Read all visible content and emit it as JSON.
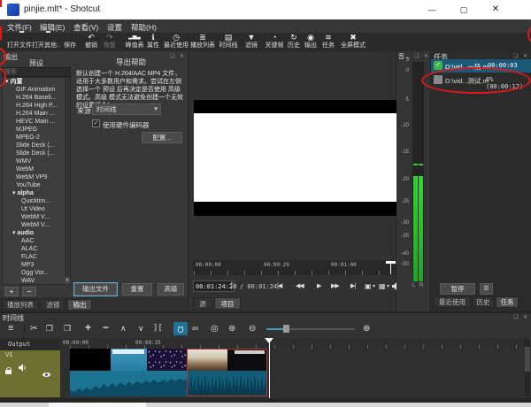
{
  "window": {
    "title": "pinjie.mlt* - Shotcut"
  },
  "menu": {
    "items": [
      "文件(F)",
      "编辑(E)",
      "查看(V)",
      "设置",
      "帮助(H)"
    ]
  },
  "toolbar": {
    "items": [
      "打开文件",
      "打开其他..",
      "保存",
      "撤销",
      "恢复",
      "峰值表",
      "属性",
      "最近使用",
      "播放列表",
      "时间线",
      "滤镜",
      "关键帧",
      "历史",
      "输出",
      "任务",
      "全屏模式"
    ]
  },
  "export_panel": {
    "title": "输出",
    "presets_title": "预设",
    "search_placeholder": "搜索",
    "group_builtin": "内置",
    "group_alpha": "alpha",
    "group_audio": "audio",
    "builtin_items": [
      "GIF Animation",
      "H.264 Baseli...",
      "H.264 High P...",
      "H.264 Main ...",
      "HEVC Main ...",
      "MJPEG",
      "MPEG-2",
      "Slide Deck (...",
      "Slide Deck (...",
      "WMV",
      "WebM",
      "WebM VP9",
      "YouTube"
    ],
    "alpha_items": [
      "Quicktim...",
      "Ut Video",
      "WebM V...",
      "WebM V..."
    ],
    "audio_items": [
      "AAC",
      "ALAC",
      "FLAC",
      "MP3",
      "Ogg Vor...",
      "WAV"
    ],
    "add_label": "+",
    "remove_label": "−",
    "help_title": "导出帮助",
    "help_text": "默认创建一个 H.264/AAC MP4 文件，适用于大多数用户和需求。尝试在左侧选择一个 预设 后再决定是否使用 高级 模式。高级 模式无法避免创建一个无效的设置组合！",
    "source_label": "来源",
    "source_value": "时间线",
    "hw_encoder_label": "使用硬件编码器",
    "configure_label": "配置...",
    "export_file": "输出文件",
    "reset": "重置",
    "advanced": "高级"
  },
  "left_tabs": {
    "items": [
      "播放列表",
      "滤镜",
      "输出"
    ]
  },
  "player": {
    "ruler": [
      "00:00:00",
      "00:00:29",
      "00:01:00"
    ],
    "position": "00:01:24:20",
    "duration": "/ 00:01:24:",
    "tabs": [
      "源",
      "项目"
    ]
  },
  "meter": {
    "title": "音…",
    "ticks": [
      "3",
      "0",
      "-5",
      "-10",
      "-15",
      "-20",
      "-25",
      "-30",
      "-35",
      "-40",
      "-50"
    ],
    "channel_l": "L",
    "channel_r": "R"
  },
  "jobs": {
    "title": "任务",
    "rows": [
      {
        "name": "D:\\vid...一段.m",
        "status": "00:00:03"
      },
      {
        "name": "D:\\vid...测试.m",
        "status": "6% (00:00:12)"
      }
    ],
    "pause": "暂停",
    "tabs": [
      "最近使用",
      "历史",
      "任务"
    ]
  },
  "timeline": {
    "title": "时间线",
    "ruler": [
      "00:00:00",
      "00:00:35"
    ],
    "track_output": "Output",
    "track_v1": "V1"
  },
  "icons": {
    "undo": "↶",
    "redo": "↷",
    "meter": "▂▅▃",
    "info": "ℹ",
    "clock": "◷",
    "playlist": "≣",
    "timeline": "▤",
    "filter": "▼",
    "keyframes": "◔",
    "history": "↻",
    "export": "◉",
    "jobs": "≋",
    "fullscreen": "✖",
    "menu": "≡",
    "cut": "✂",
    "copy": "❐",
    "paste": "❒",
    "plus": "+",
    "minus": "−",
    "up": "∧",
    "down": "∨",
    "split": "][",
    "magnet": "Ω",
    "scrub": "∞",
    "ripple": "◎",
    "ripple_all": "⊛",
    "zoom_out": "⊖",
    "zoom_in": "⊕",
    "skip_start": "|◀",
    "rewind": "◀◀",
    "play": "▶",
    "ff": "▶▶",
    "skip_end": "▶|",
    "fit": "▣",
    "grid": "▦",
    "caret": "▾",
    "spin": "▴",
    "spin2": "▾",
    "check": "✓",
    "tri": "▾",
    "dock": "❏ ✕",
    "hamburger": "☰",
    "min": "—",
    "max": "▢",
    "close": "✕"
  },
  "colors": {
    "accent": "#1f7396",
    "selection": "#1a5a78",
    "meter_green": "#2fd12f",
    "annotation": "#e01818",
    "clip_teal": "#1b7492",
    "v1_olive": "#6c7030"
  }
}
